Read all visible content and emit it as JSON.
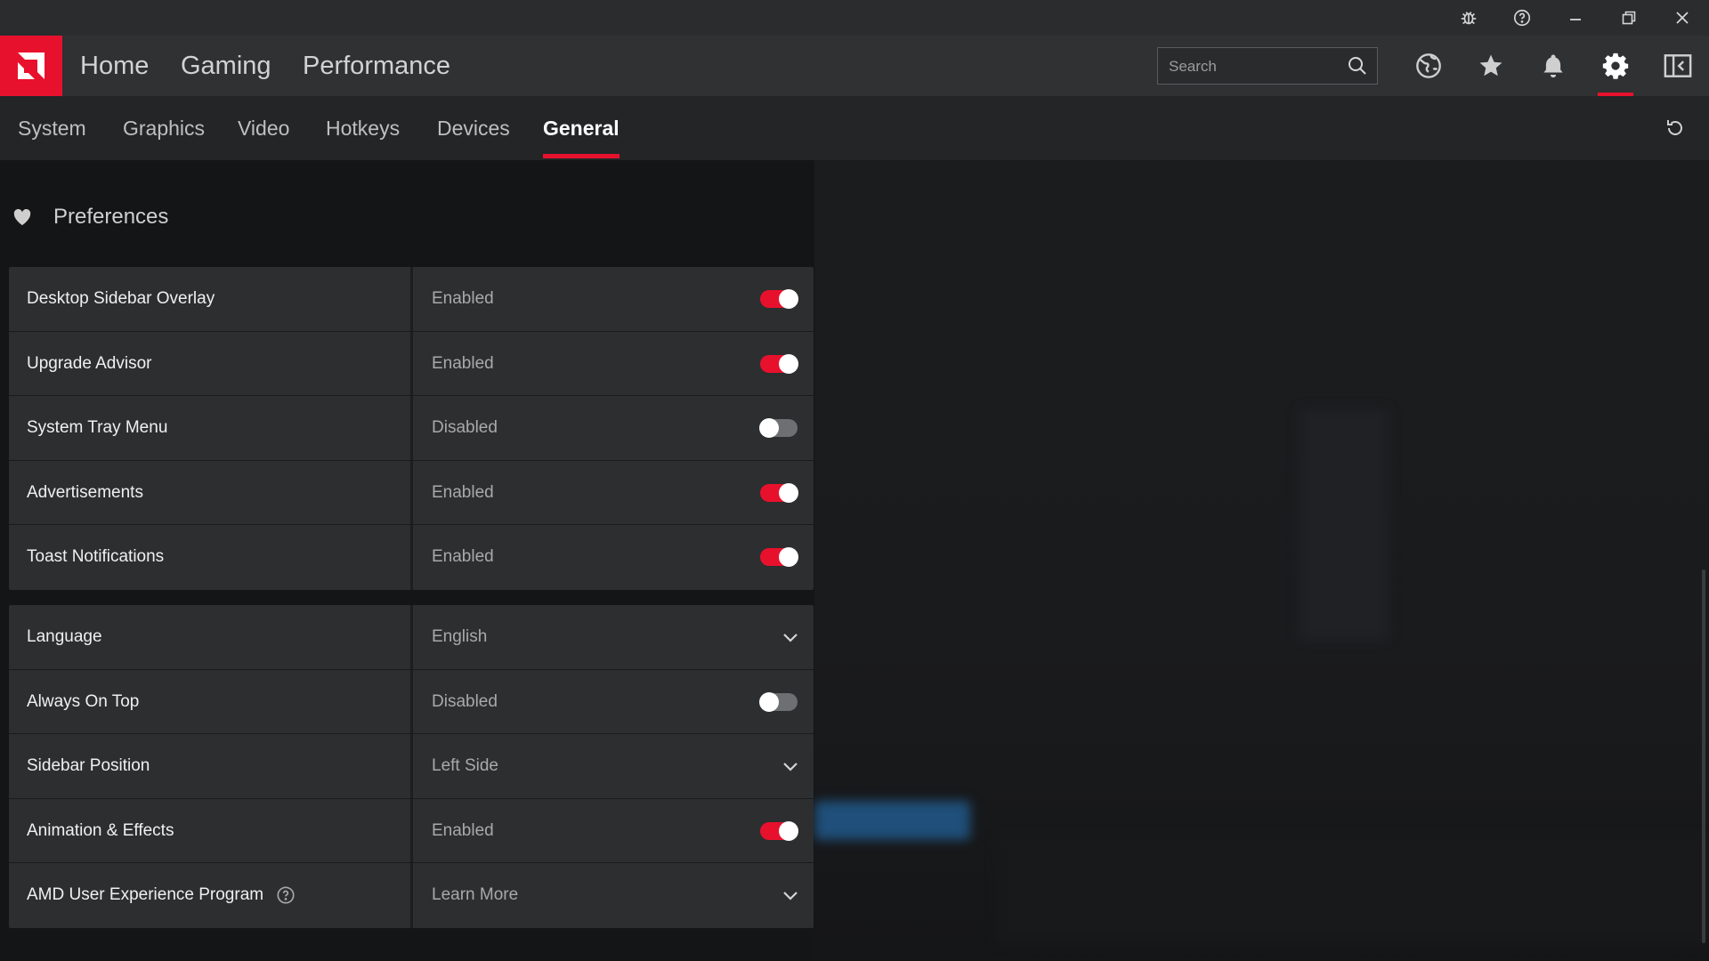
{
  "window_controls": {
    "bug_icon": "bug-icon",
    "help_icon": "help-icon",
    "minimize_icon": "minimize-icon",
    "restore_icon": "restore-icon",
    "close_icon": "close-icon"
  },
  "main_nav": {
    "tabs": [
      {
        "label": "Home"
      },
      {
        "label": "Gaming"
      },
      {
        "label": "Performance"
      }
    ],
    "search": {
      "placeholder": "Search"
    },
    "active_icon": "settings"
  },
  "sub_nav": {
    "tabs": [
      {
        "label": "System"
      },
      {
        "label": "Graphics"
      },
      {
        "label": "Video"
      },
      {
        "label": "Hotkeys"
      },
      {
        "label": "Devices"
      },
      {
        "label": "General"
      }
    ],
    "active": "General"
  },
  "preferences": {
    "title": "Preferences",
    "group1": [
      {
        "label": "Desktop Sidebar Overlay",
        "value": "Enabled",
        "control": "toggle",
        "on": true
      },
      {
        "label": "Upgrade Advisor",
        "value": "Enabled",
        "control": "toggle",
        "on": true
      },
      {
        "label": "System Tray Menu",
        "value": "Disabled",
        "control": "toggle",
        "on": false
      },
      {
        "label": "Advertisements",
        "value": "Enabled",
        "control": "toggle",
        "on": true
      },
      {
        "label": "Toast Notifications",
        "value": "Enabled",
        "control": "toggle",
        "on": true
      }
    ],
    "group2": [
      {
        "label": "Language",
        "value": "English",
        "control": "dropdown"
      },
      {
        "label": "Always On Top",
        "value": "Disabled",
        "control": "toggle",
        "on": false
      },
      {
        "label": "Sidebar Position",
        "value": "Left Side",
        "control": "dropdown"
      },
      {
        "label": "Animation & Effects",
        "value": "Enabled",
        "control": "toggle",
        "on": true
      },
      {
        "label": "AMD User Experience Program",
        "value": "Learn More",
        "control": "dropdown",
        "help": true
      }
    ]
  },
  "colors": {
    "accent": "#e8112d",
    "background": "#141516",
    "panel": "#2d2e30",
    "nav": "#303133"
  }
}
